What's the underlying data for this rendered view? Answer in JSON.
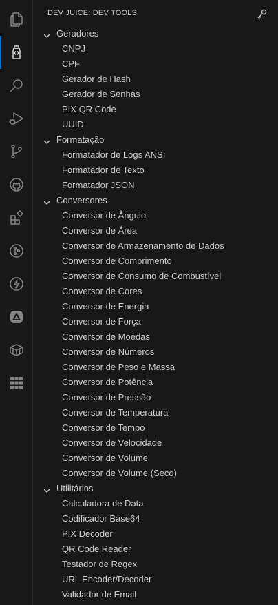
{
  "activity_bar": {
    "items": [
      {
        "icon": "files-icon"
      },
      {
        "icon": "jar-icon",
        "active": true
      },
      {
        "icon": "search-icon"
      },
      {
        "icon": "run-debug-icon"
      },
      {
        "icon": "source-control-icon"
      },
      {
        "icon": "github-icon"
      },
      {
        "icon": "extensions-icon"
      },
      {
        "icon": "git-graph-icon"
      },
      {
        "icon": "lightning-icon"
      },
      {
        "icon": "azure-icon"
      },
      {
        "icon": "package-icon"
      },
      {
        "icon": "grid-icon"
      }
    ]
  },
  "sidebar": {
    "title": "DEV JUICE: DEV TOOLS",
    "header_action_icon": "key-icon",
    "groups": [
      {
        "label": "Geradores",
        "expanded": true,
        "items": [
          "CNPJ",
          "CPF",
          "Gerador de Hash",
          "Gerador de Senhas",
          "PIX QR Code",
          "UUID"
        ]
      },
      {
        "label": "Formatação",
        "expanded": true,
        "items": [
          "Formatador de Logs ANSI",
          "Formatador de Texto",
          "Formatador JSON"
        ]
      },
      {
        "label": "Conversores",
        "expanded": true,
        "items": [
          "Conversor de Ângulo",
          "Conversor de Área",
          "Conversor de Armazenamento de Dados",
          "Conversor de Comprimento",
          "Conversor de Consumo de Combustível",
          "Conversor de Cores",
          "Conversor de Energia",
          "Conversor de Força",
          "Conversor de Moedas",
          "Conversor de Números",
          "Conversor de Peso e Massa",
          "Conversor de Potência",
          "Conversor de Pressão",
          "Conversor de Temperatura",
          "Conversor de Tempo",
          "Conversor de Velocidade",
          "Conversor de Volume",
          "Conversor de Volume (Seco)"
        ]
      },
      {
        "label": "Utilitários",
        "expanded": true,
        "items": [
          "Calculadora de Data",
          "Codificador Base64",
          "PIX Decoder",
          "QR Code Reader",
          "Testador de Regex",
          "URL Encoder/Decoder",
          "Validador de Email"
        ]
      }
    ]
  }
}
